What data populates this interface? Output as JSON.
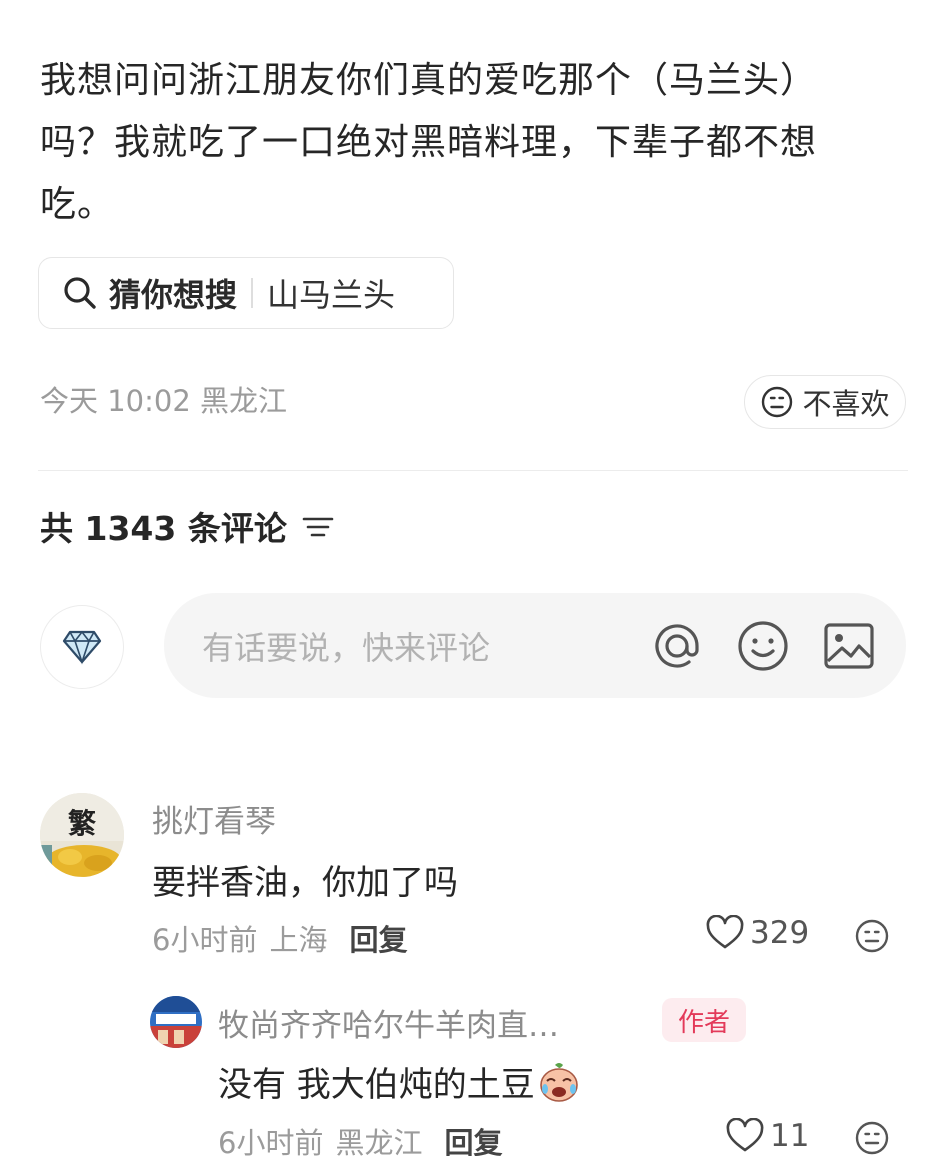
{
  "post": {
    "text_line1": "我想问问浙江朋友你们真的爱吃那个（马兰头）",
    "text_line2": "吗？我就吃了一口绝对黑暗料理，下辈子都不想",
    "text_line3": "吃。"
  },
  "search_hint": {
    "title": "猜你想搜",
    "query": "山马兰头",
    "icon": "search-icon"
  },
  "post_meta": {
    "date": "今天 10:02",
    "location": "黑龙江",
    "dislike_label": "不喜欢"
  },
  "comments_section": {
    "count_label": "共 1343 条评论",
    "input_placeholder": "有话要说，快来评论"
  },
  "comments": [
    {
      "author": "挑灯看琴",
      "text": "要拌香油，你加了吗",
      "time": "6小时前",
      "location": "上海",
      "reply_label": "回复",
      "likes": "329"
    }
  ],
  "replies": [
    {
      "author": "牧尚齐齐哈尔牛羊肉直…",
      "tag": "作者",
      "text": "没有 我大伯炖的土豆",
      "time": "6小时前",
      "location": "黑龙江",
      "reply_label": "回复",
      "likes": "11"
    }
  ],
  "colors": {
    "accent_tag_bg": "#fdecef",
    "accent_tag_text": "#e33a5a",
    "meta_gray": "#9b9b9b"
  }
}
